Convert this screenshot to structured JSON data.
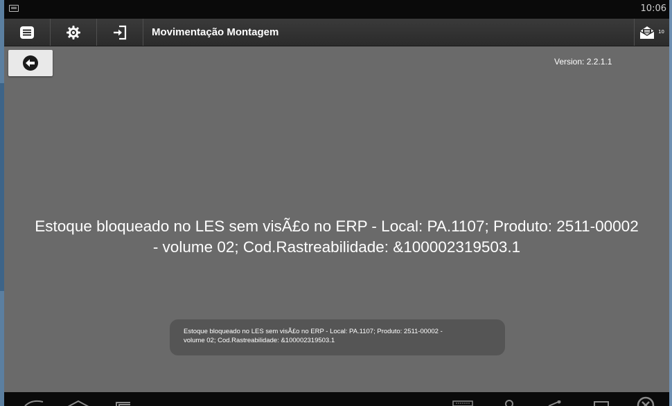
{
  "status_bar": {
    "time": "10:06"
  },
  "action_bar": {
    "title": "Movimentação Montagem",
    "mail_count": "10"
  },
  "version": "Version: 2.2.1.1",
  "message": {
    "line1": "Estoque bloqueado no LES sem visÃ£o no ERP - Local: PA.1107; Produto: 2511-00002",
    "line2": "- volume 02; Cod.Rastreabilidade: &100002319503.1"
  },
  "toast": {
    "line1": "Estoque bloqueado no LES sem visÃ£o no ERP - Local: PA.1107; Produto: 2511-00002 -",
    "line2": "volume 02; Cod.Rastreabilidade: &100002319503.1"
  },
  "icons": {
    "menu": "menu-icon",
    "settings": "gear-icon",
    "login": "login-icon",
    "mail": "mail-icon",
    "back": "back-arrow-icon"
  }
}
